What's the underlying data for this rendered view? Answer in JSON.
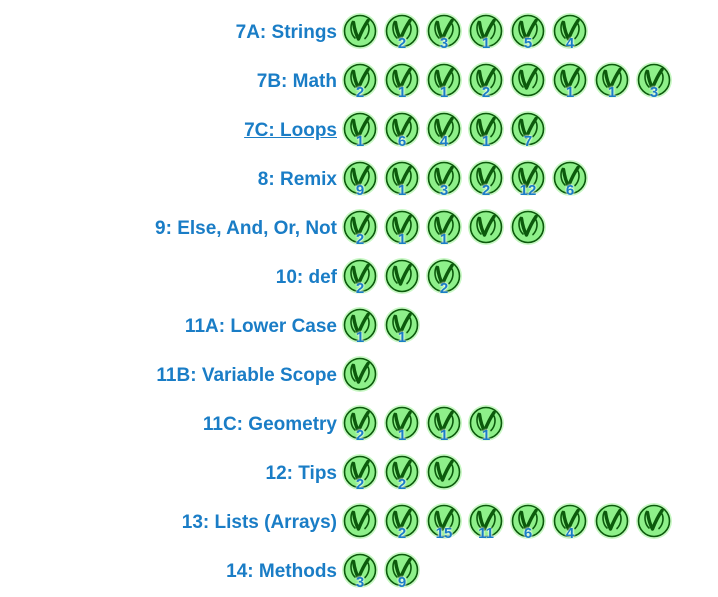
{
  "lessons": [
    {
      "title": "7A: Strings",
      "underlined": false,
      "badges": [
        "",
        "2",
        "3",
        "1",
        "5",
        "4"
      ]
    },
    {
      "title": "7B: Math",
      "underlined": false,
      "badges": [
        "2",
        "1",
        "1",
        "2",
        "",
        "1",
        "1",
        "3"
      ]
    },
    {
      "title": "7C: Loops",
      "underlined": true,
      "badges": [
        "1",
        "6",
        "4",
        "1",
        "7"
      ]
    },
    {
      "title": "8: Remix",
      "underlined": false,
      "badges": [
        "9",
        "1",
        "3",
        "2",
        "12",
        "6"
      ]
    },
    {
      "title": "9: Else, And, Or, Not",
      "underlined": false,
      "badges": [
        "2",
        "1",
        "1",
        "",
        ""
      ]
    },
    {
      "title": "10: def",
      "underlined": false,
      "badges": [
        "2",
        "",
        "2"
      ]
    },
    {
      "title": "11A: Lower Case",
      "underlined": false,
      "badges": [
        "1",
        "1"
      ]
    },
    {
      "title": "11B: Variable Scope",
      "underlined": false,
      "badges": [
        ""
      ]
    },
    {
      "title": "11C: Geometry",
      "underlined": false,
      "badges": [
        "2",
        "1",
        "1",
        "1"
      ]
    },
    {
      "title": "12: Tips",
      "underlined": false,
      "badges": [
        "2",
        "2",
        ""
      ]
    },
    {
      "title": "13: Lists (Arrays)",
      "underlined": false,
      "badges": [
        "",
        "2",
        "15",
        "11",
        "6",
        "4",
        "",
        ""
      ]
    },
    {
      "title": "14: Methods",
      "underlined": false,
      "badges": [
        "3",
        "9"
      ]
    }
  ],
  "colors": {
    "title": "#1a7dc6",
    "badge_fill": "#8ef08a",
    "badge_glow": "#c8f8c4",
    "badge_stroke": "#0c5a0c",
    "count": "#1a7dc6"
  },
  "icons": {
    "badge": "checkmark-circle-icon"
  }
}
